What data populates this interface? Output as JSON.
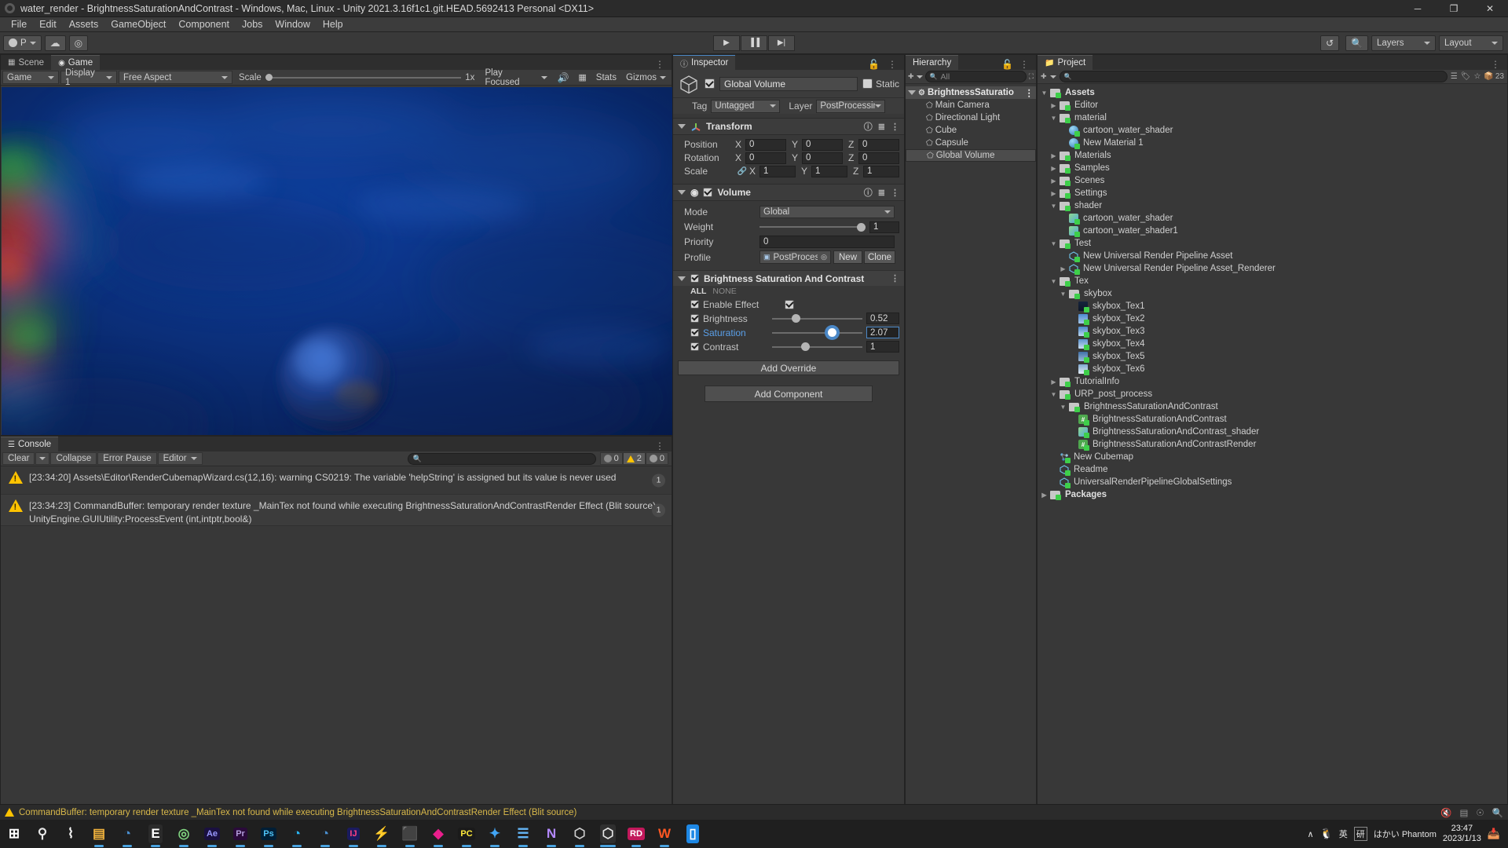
{
  "titlebar": {
    "title": "water_render - BrightnessSaturationAndContrast - Windows, Mac, Linux - Unity 2021.3.16f1c1.git.HEAD.5692413 Personal <DX11>",
    "minimize": "─",
    "maximize": "❐",
    "close": "✕"
  },
  "menubar": {
    "items": [
      "File",
      "Edit",
      "Assets",
      "GameObject",
      "Component",
      "Jobs",
      "Window",
      "Help"
    ]
  },
  "toolbar": {
    "account_label": "P",
    "cloud_icon": "cloud-icon",
    "services_icon": "services-icon",
    "play": "▶",
    "pause": "▐▐",
    "step": "▶|",
    "history_icon": "undo-history-icon",
    "search_icon": "search-icon",
    "layers": "Layers",
    "layout": "Layout"
  },
  "game_panel": {
    "tabs": [
      {
        "label": "Scene",
        "icon": "scene-grid-icon",
        "active": false
      },
      {
        "label": "Game",
        "icon": "gamepad-icon",
        "active": true
      }
    ],
    "view_mode": "Game",
    "display": "Display 1",
    "aspect": "Free Aspect",
    "scale_label": "Scale",
    "scale_value": "1x",
    "play_mode": "Play Focused",
    "mute_icon": "speaker-icon",
    "stats": "Stats",
    "gizmos": "Gizmos"
  },
  "console_panel": {
    "tab": "Console",
    "clear": "Clear",
    "collapse": "Collapse",
    "error_pause": "Error Pause",
    "editor": "Editor",
    "search_placeholder": "",
    "counts": {
      "info": "0",
      "warning": "2",
      "error": "0"
    },
    "logs": [
      {
        "time": "[23:34:20]",
        "text": "[23:34:20] Assets\\Editor\\RenderCubemapWizard.cs(12,16): warning CS0219: The variable 'helpString' is assigned but its value is never used",
        "sub": "",
        "count": "1",
        "type": "warning"
      },
      {
        "time": "[23:34:23]",
        "text": "[23:34:23] CommandBuffer: temporary render texture _MainTex not found while executing BrightnessSaturationAndContrastRender Effect (Blit source)",
        "sub": "UnityEngine.GUIUtility:ProcessEvent (int,intptr,bool&)",
        "count": "1",
        "type": "warning"
      }
    ]
  },
  "inspector": {
    "tab": "Inspector",
    "lock_icon": "lock-icon",
    "object_name": "Global Volume",
    "static_label": "Static",
    "tag_label": "Tag",
    "tag_value": "Untagged",
    "layer_label": "Layer",
    "layer_value": "PostProcessing",
    "transform": {
      "title": "Transform",
      "rows": [
        {
          "label": "Position",
          "x": "0",
          "y": "0",
          "z": "0"
        },
        {
          "label": "Rotation",
          "x": "0",
          "y": "0",
          "z": "0"
        },
        {
          "label": "Scale",
          "x": "1",
          "y": "1",
          "z": "1"
        }
      ],
      "axes": [
        "X",
        "Y",
        "Z"
      ]
    },
    "volume": {
      "title": "Volume",
      "mode_label": "Mode",
      "mode_value": "Global",
      "weight_label": "Weight",
      "weight_value": "1",
      "priority_label": "Priority",
      "priority_value": "0",
      "profile_label": "Profile",
      "profile_value": "PostProcessing'",
      "new_button": "New",
      "clone_button": "Clone"
    },
    "effect": {
      "title": "Brightness Saturation And Contrast",
      "all_label": "ALL",
      "none_label": "NONE",
      "rows": [
        {
          "label": "Enable Effect",
          "type": "bool",
          "value": "",
          "checked": true
        },
        {
          "label": "Brightness",
          "type": "slider",
          "value": "0.52",
          "fill": 0.22,
          "focused": false,
          "highlight": false
        },
        {
          "label": "Saturation",
          "type": "slider",
          "value": "2.07",
          "fill": 0.62,
          "focused": true,
          "highlight": true
        },
        {
          "label": "Contrast",
          "type": "slider",
          "value": "1",
          "fill": 0.32,
          "focused": false,
          "highlight": false
        }
      ]
    },
    "add_override": "Add Override",
    "add_component": "Add Component"
  },
  "hierarchy": {
    "tab": "Hierarchy",
    "search_placeholder": "All",
    "root": "BrightnessSaturatio",
    "items": [
      {
        "label": "Main Camera",
        "selected": false
      },
      {
        "label": "Directional Light",
        "selected": false
      },
      {
        "label": "Cube",
        "selected": false
      },
      {
        "label": "Capsule",
        "selected": false
      },
      {
        "label": "Global Volume",
        "selected": true
      }
    ]
  },
  "project": {
    "tab": "Project",
    "search_placeholder": "",
    "badge_count": "23",
    "tree": [
      {
        "label": "Assets",
        "depth": 0,
        "icon": "folder-open",
        "arrow": "down",
        "bold": true
      },
      {
        "label": "Editor",
        "depth": 1,
        "icon": "folder",
        "arrow": "right"
      },
      {
        "label": "material",
        "depth": 1,
        "icon": "folder-open",
        "arrow": "down"
      },
      {
        "label": "cartoon_water_shader",
        "depth": 2,
        "icon": "material",
        "arrow": ""
      },
      {
        "label": "New Material 1",
        "depth": 2,
        "icon": "material",
        "arrow": ""
      },
      {
        "label": "Materials",
        "depth": 1,
        "icon": "folder",
        "arrow": "right"
      },
      {
        "label": "Samples",
        "depth": 1,
        "icon": "folder",
        "arrow": "right"
      },
      {
        "label": "Scenes",
        "depth": 1,
        "icon": "folder",
        "arrow": "right"
      },
      {
        "label": "Settings",
        "depth": 1,
        "icon": "folder",
        "arrow": "right"
      },
      {
        "label": "shader",
        "depth": 1,
        "icon": "folder-open",
        "arrow": "down"
      },
      {
        "label": "cartoon_water_shader",
        "depth": 2,
        "icon": "shader",
        "arrow": ""
      },
      {
        "label": "cartoon_water_shader1",
        "depth": 2,
        "icon": "shader",
        "arrow": ""
      },
      {
        "label": "Test",
        "depth": 1,
        "icon": "folder-open",
        "arrow": "down"
      },
      {
        "label": "New Universal Render Pipeline Asset",
        "depth": 2,
        "icon": "prefab",
        "arrow": ""
      },
      {
        "label": "New Universal Render Pipeline Asset_Renderer",
        "depth": 2,
        "icon": "prefab",
        "arrow": "right"
      },
      {
        "label": "Tex",
        "depth": 1,
        "icon": "folder-open",
        "arrow": "down"
      },
      {
        "label": "skybox",
        "depth": 2,
        "icon": "folder-open",
        "arrow": "down"
      },
      {
        "label": "skybox_Tex1",
        "depth": 3,
        "icon": "tex1",
        "arrow": ""
      },
      {
        "label": "skybox_Tex2",
        "depth": 3,
        "icon": "tex2",
        "arrow": ""
      },
      {
        "label": "skybox_Tex3",
        "depth": 3,
        "icon": "tex3",
        "arrow": ""
      },
      {
        "label": "skybox_Tex4",
        "depth": 3,
        "icon": "tex4",
        "arrow": ""
      },
      {
        "label": "skybox_Tex5",
        "depth": 3,
        "icon": "tex5",
        "arrow": ""
      },
      {
        "label": "skybox_Tex6",
        "depth": 3,
        "icon": "tex6",
        "arrow": ""
      },
      {
        "label": "TutorialInfo",
        "depth": 1,
        "icon": "folder",
        "arrow": "right"
      },
      {
        "label": "URP_post_process",
        "depth": 1,
        "icon": "folder-open",
        "arrow": "down"
      },
      {
        "label": "BrightnessSaturationAndContrast",
        "depth": 2,
        "icon": "folder-open",
        "arrow": "down"
      },
      {
        "label": "BrightnessSaturationAndContrast",
        "depth": 3,
        "icon": "script",
        "arrow": ""
      },
      {
        "label": "BrightnessSaturationAndContrast_shader",
        "depth": 3,
        "icon": "shader",
        "arrow": ""
      },
      {
        "label": "BrightnessSaturationAndContrastRender",
        "depth": 3,
        "icon": "script",
        "arrow": ""
      },
      {
        "label": "New Cubemap",
        "depth": 1,
        "icon": "cubemap",
        "arrow": ""
      },
      {
        "label": "Readme",
        "depth": 1,
        "icon": "prefab",
        "arrow": ""
      },
      {
        "label": "UniversalRenderPipelineGlobalSettings",
        "depth": 1,
        "icon": "prefab",
        "arrow": ""
      },
      {
        "label": "Packages",
        "depth": 0,
        "icon": "folder-plain",
        "arrow": "right",
        "bold": true
      }
    ]
  },
  "statusbar": {
    "message": "CommandBuffer: temporary render texture _MainTex not found while executing BrightnessSaturationAndContrastRender Effect (Blit source)",
    "icons": [
      "mute-icon",
      "layers-icon",
      "collab-icon",
      "search-icon"
    ]
  },
  "taskbar": {
    "items": [
      {
        "name": "start-button",
        "glyph": "⊞",
        "color": "#ffffff",
        "bg": ""
      },
      {
        "name": "search-icon",
        "glyph": "⚲",
        "color": "#e6e6e6",
        "bg": ""
      },
      {
        "name": "app-slack",
        "glyph": "⌇",
        "color": "#f2f2f2",
        "bg": ""
      },
      {
        "name": "app-file-explorer",
        "glyph": "▤",
        "color": "#f2b33d",
        "bg": ""
      },
      {
        "name": "app-steam",
        "glyph": "◔",
        "color": "#4a8fd0",
        "bg": ""
      },
      {
        "name": "app-epic-games",
        "glyph": "E",
        "color": "#ffffff",
        "bg": "#2a2a2a"
      },
      {
        "name": "app-spiral",
        "glyph": "◎",
        "color": "#7fd27f",
        "bg": ""
      },
      {
        "name": "app-after-effects",
        "glyph": "Ae",
        "color": "#9999ff",
        "bg": "#1a1040"
      },
      {
        "name": "app-premiere",
        "glyph": "Pr",
        "color": "#b39ddb",
        "bg": "#2a0a3a"
      },
      {
        "name": "app-photoshop",
        "glyph": "Ps",
        "color": "#4fc3f7",
        "bg": "#001e36"
      },
      {
        "name": "app-edge",
        "glyph": "◔",
        "color": "#29b6f6",
        "bg": ""
      },
      {
        "name": "app-steam-2",
        "glyph": "◔",
        "color": "#4a8fd0",
        "bg": ""
      },
      {
        "name": "app-intellij",
        "glyph": "IJ",
        "color": "#ff4081",
        "bg": "#1a1a5e"
      },
      {
        "name": "app-blue-bolt",
        "glyph": "⚡",
        "color": "#2196f3",
        "bg": ""
      },
      {
        "name": "app-windows-tiles",
        "glyph": "⬛",
        "color": "#e74c3c",
        "bg": ""
      },
      {
        "name": "app-pink-diamond",
        "glyph": "◆",
        "color": "#e91e8c",
        "bg": ""
      },
      {
        "name": "app-pc",
        "glyph": "PC",
        "color": "#ffeb3b",
        "bg": "#1a1a1a"
      },
      {
        "name": "app-blue-bird",
        "glyph": "✦",
        "color": "#42a5f5",
        "bg": ""
      },
      {
        "name": "app-charts",
        "glyph": "☰",
        "color": "#64b5f6",
        "bg": ""
      },
      {
        "name": "app-visual-studio",
        "glyph": "N",
        "color": "#b388ff",
        "bg": ""
      },
      {
        "name": "app-unity-1",
        "glyph": "⬡",
        "color": "#cfcfcf",
        "bg": ""
      },
      {
        "name": "app-unity-2",
        "glyph": "⬡",
        "color": "#e8e8e8",
        "bg": "#2f2f2f"
      },
      {
        "name": "app-rider",
        "glyph": "RD",
        "color": "#ffffff",
        "bg": "#c2185b"
      },
      {
        "name": "app-wondershare",
        "glyph": "W",
        "color": "#ff5722",
        "bg": ""
      },
      {
        "name": "app-phone-link",
        "glyph": "▯",
        "color": "#ffffff",
        "bg": "#1e88e5"
      }
    ],
    "tray": {
      "chevron": "∧",
      "ime": "英",
      "ime2": "研",
      "text": "はかい Phantom",
      "time": "23:47",
      "date": "2023/1/13",
      "notification_icon": "notification-icon"
    }
  }
}
